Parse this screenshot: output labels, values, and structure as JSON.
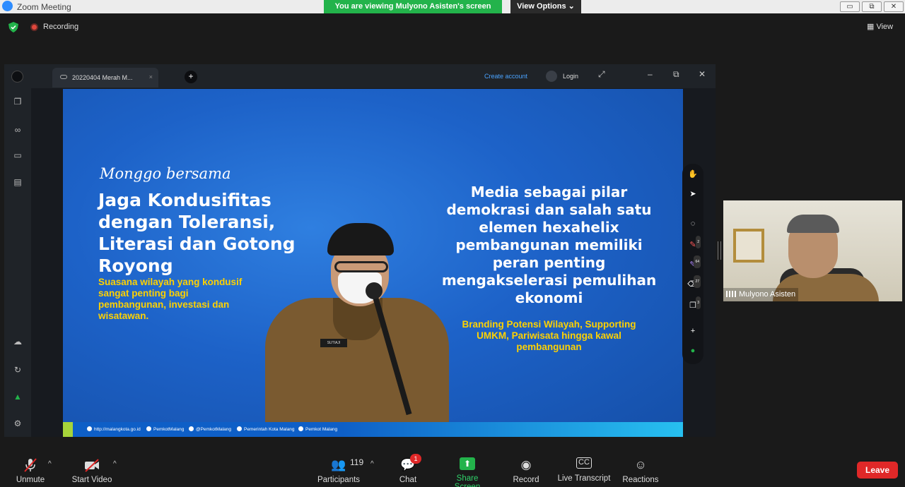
{
  "window": {
    "title": "Zoom Meeting",
    "viewing_banner": "You are viewing Mulyono Asisten's screen",
    "view_options": "View Options",
    "minimize": "▭",
    "restore": "⧉",
    "close": "✕"
  },
  "meeting": {
    "recording_label": "Recording",
    "view_label": "View"
  },
  "shared_app": {
    "tab_title": "20220404 Merah M...",
    "tab_close": "×",
    "new_tab": "+",
    "create_account": "Create account",
    "login": "Login"
  },
  "slide": {
    "script_line": "Monggo bersama",
    "headline": "Jaga Kondusifitas dengan Toleransi, Literasi dan Gotong Royong",
    "sub_text": "Suasana wilayah yang kondusif sangat penting bagi pembangunan, investasi dan wisatawan.",
    "right_headline": "Media sebagai pilar demokrasi dan salah satu elemen hexahelix pembangunan memiliki peran penting mengakselerasi pemulihan ekonomi",
    "right_sub": "Branding Potensi Wilayah, Supporting UMKM, Pariwisata hingga kawal pembangunan",
    "name_tag": "SUTIAJI",
    "socials": [
      "http://malangkota.go.id",
      "PemkotMalang",
      "@PemkotMalang",
      "Pemerintah Kota Malang",
      "Pemkot Malang"
    ]
  },
  "annotation_toolbar": {
    "badges": [
      "2",
      "64",
      "27",
      "3"
    ]
  },
  "participant_video": {
    "name": "Mulyono Asisten"
  },
  "toolbar": {
    "unmute": "Unmute",
    "start_video": "Start Video",
    "participants": "Participants",
    "participants_count": "119",
    "chat": "Chat",
    "chat_badge": "1",
    "share_screen": "Share Screen",
    "record": "Record",
    "live_transcript": "Live Transcript",
    "reactions": "Reactions",
    "leave": "Leave"
  },
  "colors": {
    "share_green": "#23b34b",
    "leave_red": "#e02828",
    "slide_blue": "#1d62c8",
    "slide_yellow": "#ffd200"
  }
}
